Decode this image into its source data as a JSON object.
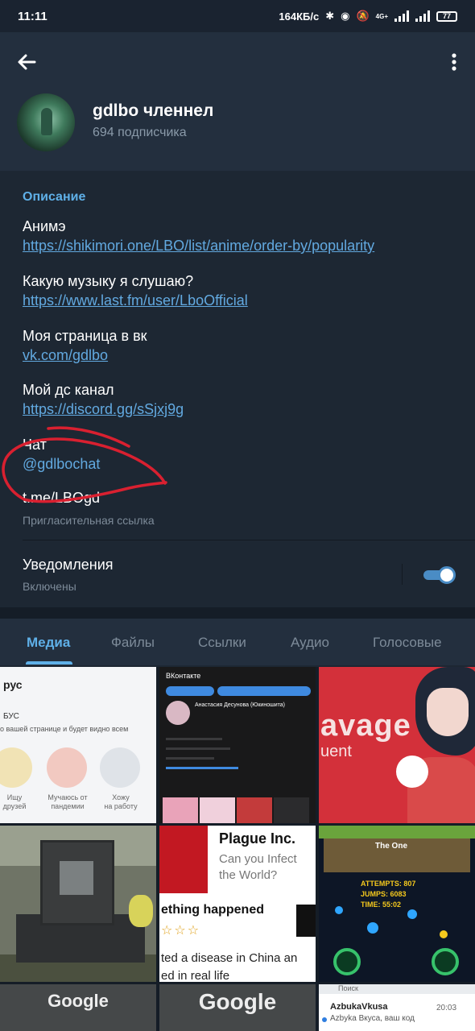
{
  "status_bar": {
    "time": "11:11",
    "network_speed": "164КБ/с",
    "network_type": "4G+",
    "battery": "77"
  },
  "header": {
    "channel_name": "gdlbo членнел",
    "subscribers": "694 подписчика"
  },
  "info": {
    "section_title": "Описание",
    "description": [
      {
        "text": "Анимэ",
        "link": "https://shikimori.one/LBO/list/anime/order-by/popularity"
      },
      {
        "text": "Какую музыку я слушаю?",
        "link": "https://www.last.fm/user/LboOfficial"
      },
      {
        "text": "Моя страница в вк",
        "link": "vk.com/gdlbo"
      },
      {
        "text": "Мой дс канал",
        "link": "https://discord.gg/sSjxj9g"
      },
      {
        "text": "Чат",
        "link": "@gdlbochat"
      }
    ],
    "invite_link": "t.me/LBOgd",
    "invite_label": "Пригласительная ссылка",
    "notifications_title": "Уведомления",
    "notifications_state": "Включены",
    "notifications_enabled": true
  },
  "tabs": [
    "Медиа",
    "Файлы",
    "Ссылки",
    "Аудио",
    "Голосовые"
  ],
  "media": {
    "cell1": {
      "title": "рус",
      "subtitle": "БУС",
      "line": "о вашей странице и будет видно всем",
      "labels": [
        "Ищу\nдрузей",
        "Мучаюсь от\nпандемии",
        "Хожу\nна работу"
      ]
    },
    "cell2": {
      "header": "ВКонтакте",
      "name": "Анастасия Десунова (Юкиношита)"
    },
    "cell3": {
      "word": "avage",
      "word2": "uent"
    },
    "cell5": {
      "title": "Plague Inc.",
      "subtitle": "Can you Infect the World?",
      "heading": "ething happened",
      "body": "ted a disease in China an\ned in real life"
    },
    "cell6": {
      "panel": "The One",
      "stats": "ATTEMPTS: 807\nJUMPS: 6083\nTIME: 55:02"
    },
    "cell7": {
      "word": "Google"
    },
    "cell8": {
      "word": "Google"
    },
    "cell9": {
      "search": "Поиск",
      "app": "AzbukaVkusa",
      "time": "20:03",
      "message": "Azbyka Вкуса, ваш код"
    }
  },
  "colors": {
    "background": "#1d2733",
    "header": "#232f3e",
    "accent": "#5fb0e8",
    "link": "#62a9e0",
    "annotation_red": "#d92030"
  }
}
